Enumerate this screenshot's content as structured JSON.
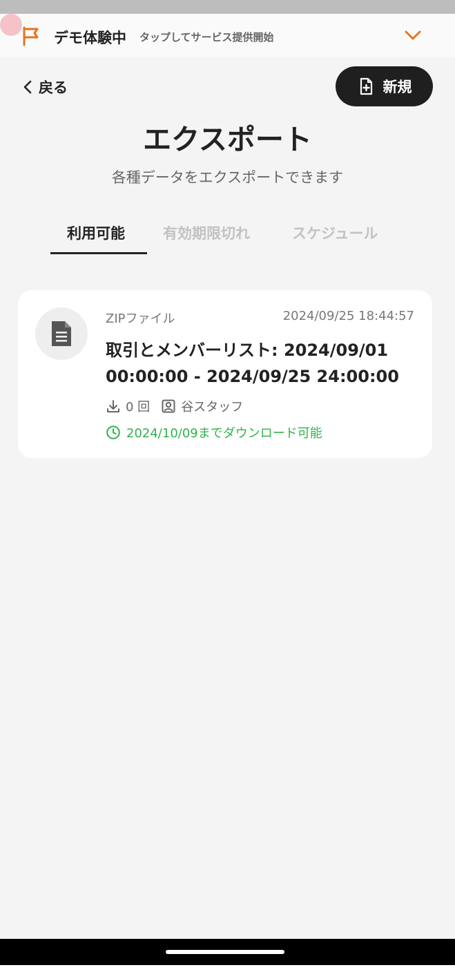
{
  "colors": {
    "accent": "#e8731c",
    "primary_button_bg": "#1f1f1f",
    "success": "#2fb24a",
    "background": "#f4f4f4"
  },
  "demo_banner": {
    "title": "デモ体験中",
    "subtitle": "タップしてサービス提供開始",
    "flag_icon": "flag-icon",
    "chevron_icon": "chevron-down-icon"
  },
  "header": {
    "back_label": "戻る",
    "new_label": "新規"
  },
  "page": {
    "title": "エクスポート",
    "subtitle": "各種データをエクスポートできます"
  },
  "tabs": [
    {
      "label": "利用可能",
      "active": true
    },
    {
      "label": "有効期限切れ",
      "active": false
    },
    {
      "label": "スケジュール",
      "active": false
    }
  ],
  "exports": [
    {
      "file_type": "ZIPファイル",
      "created_at": "2024/09/25 18:44:57",
      "title": "取引とメンバーリスト: 2024/09/01 00:00:00 - 2024/09/25 24:00:00",
      "download_count": "0 回",
      "staff": "谷スタッフ",
      "expiry": "2024/10/09までダウンロード可能"
    }
  ]
}
